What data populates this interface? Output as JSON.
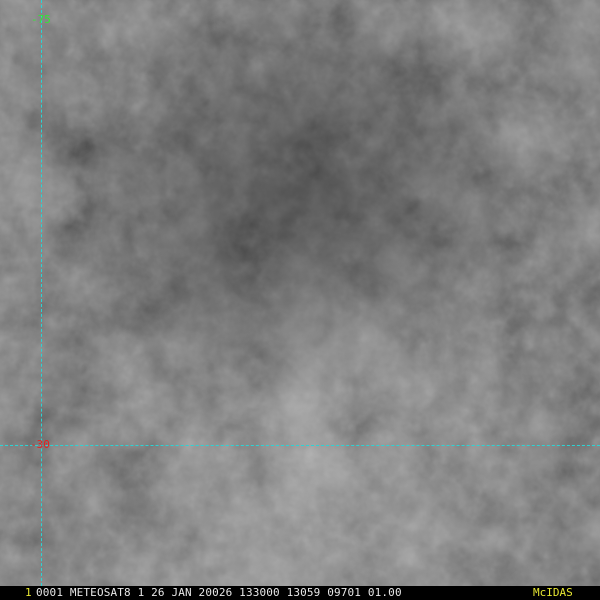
{
  "image": {
    "description_colors": {
      "background": "#1b1b1b",
      "grid": "#2bd4d4"
    }
  },
  "grid": {
    "lon_label": "-75",
    "lon_label_color": "#33e633",
    "lat_label": "-30",
    "lat_label_color": "#e62020"
  },
  "status_bar": {
    "frame_number": "1",
    "frame_number_color": "#e6e633",
    "text": "0001 METEOSAT8    1 26 JAN 20026 133000 13059 09701 01.00",
    "text_color": "#e8e8e8",
    "brand": "McIDAS",
    "brand_color": "#e6e633"
  }
}
